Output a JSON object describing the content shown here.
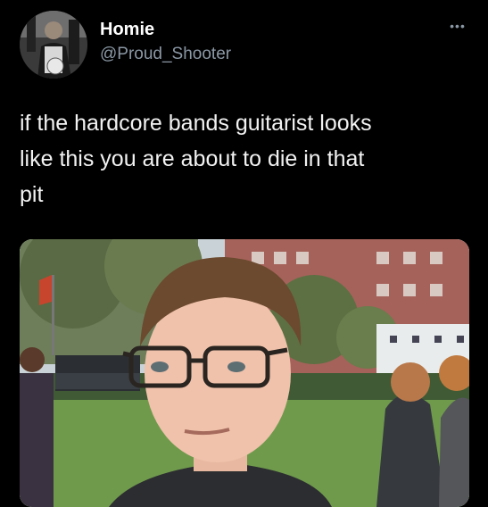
{
  "tweet": {
    "display_name": "Homie",
    "handle": "@Proud_Shooter",
    "text": "if the hardcore bands guitarist looks\nlike this you are about to die in that\npit",
    "more_glyph": "•••"
  },
  "icons": {
    "more": "more-options-icon",
    "avatar": "profile-avatar"
  },
  "media": {
    "type": "photo"
  },
  "colors": {
    "background": "#000000",
    "text_primary": "#f2f2f2",
    "text_secondary": "#8b98a5"
  }
}
